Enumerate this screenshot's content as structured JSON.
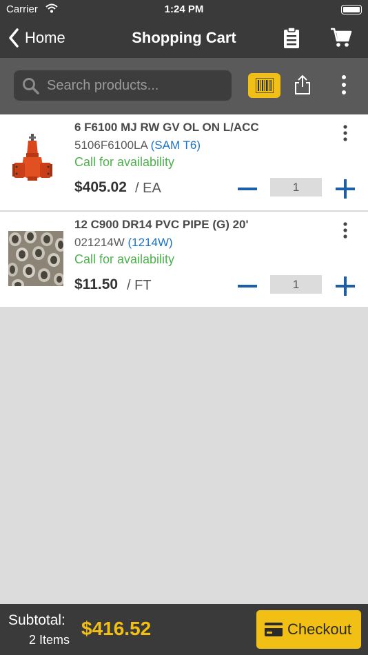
{
  "status_bar": {
    "carrier": "Carrier",
    "time": "1:24 PM"
  },
  "nav": {
    "back_label": "Home",
    "title": "Shopping Cart"
  },
  "search": {
    "placeholder": "Search products..."
  },
  "items": [
    {
      "name": "6 F6100 MJ RW GV OL ON L/ACC",
      "sku": "5106F6100LA",
      "alt_code": "(SAM T6)",
      "availability": "Call for availability",
      "price": "$405.02",
      "unit": "/ EA",
      "quantity": "1"
    },
    {
      "name": "12 C900 DR14 PVC PIPE (G) 20'",
      "sku": "021214W",
      "alt_code": "(1214W)",
      "availability": "Call for availability",
      "price": "$11.50",
      "unit": "/ FT",
      "quantity": "1"
    }
  ],
  "footer": {
    "subtotal_label": "Subtotal:",
    "items_count": "2 Items",
    "total": "$416.52",
    "checkout_label": "Checkout"
  },
  "colors": {
    "accent": "#f2c014",
    "dark": "#3a3a3a",
    "link": "#1a73c6",
    "available": "#4db04d",
    "qty_button": "#1a5fa8"
  },
  "icons": [
    "back-chevron-icon",
    "clipboard-icon",
    "cart-icon",
    "search-icon",
    "barcode-icon",
    "share-icon",
    "more-vertical-icon",
    "minus-icon",
    "plus-icon",
    "credit-card-icon"
  ]
}
